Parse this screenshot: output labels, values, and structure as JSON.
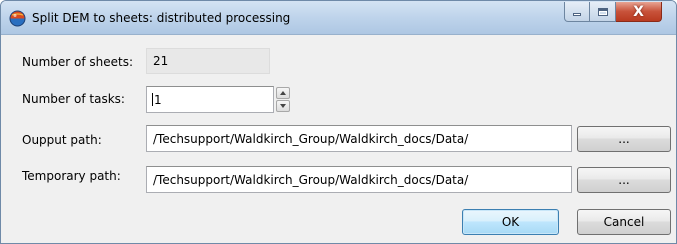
{
  "window": {
    "title": "Split DEM to sheets: distributed processing",
    "close_glyph": "X"
  },
  "form": {
    "sheets_label": "Number of sheets:",
    "sheets_value": "21",
    "tasks_label": "Number of tasks:",
    "tasks_value": "1",
    "output_label": "Oupput path:",
    "output_value": "/Techsupport/Waldkirch_Group/Waldkirch_docs/Data/",
    "temp_label": "Temporary path:",
    "temp_value": "/Techsupport/Waldkirch_Group/Waldkirch_docs/Data/"
  },
  "buttons": {
    "browse_output": "...",
    "browse_temp": "...",
    "ok": "OK",
    "cancel": "Cancel"
  },
  "icons": {
    "app": "globe-icon",
    "minimize": "minimize-icon",
    "maximize": "maximize-icon",
    "close": "close-icon",
    "spin_up": "chevron-up-icon",
    "spin_down": "chevron-down-icon"
  },
  "colors": {
    "titlebar": "#bcd2ea",
    "close_button": "#c8523a",
    "default_button_border": "#3c7fb1"
  }
}
